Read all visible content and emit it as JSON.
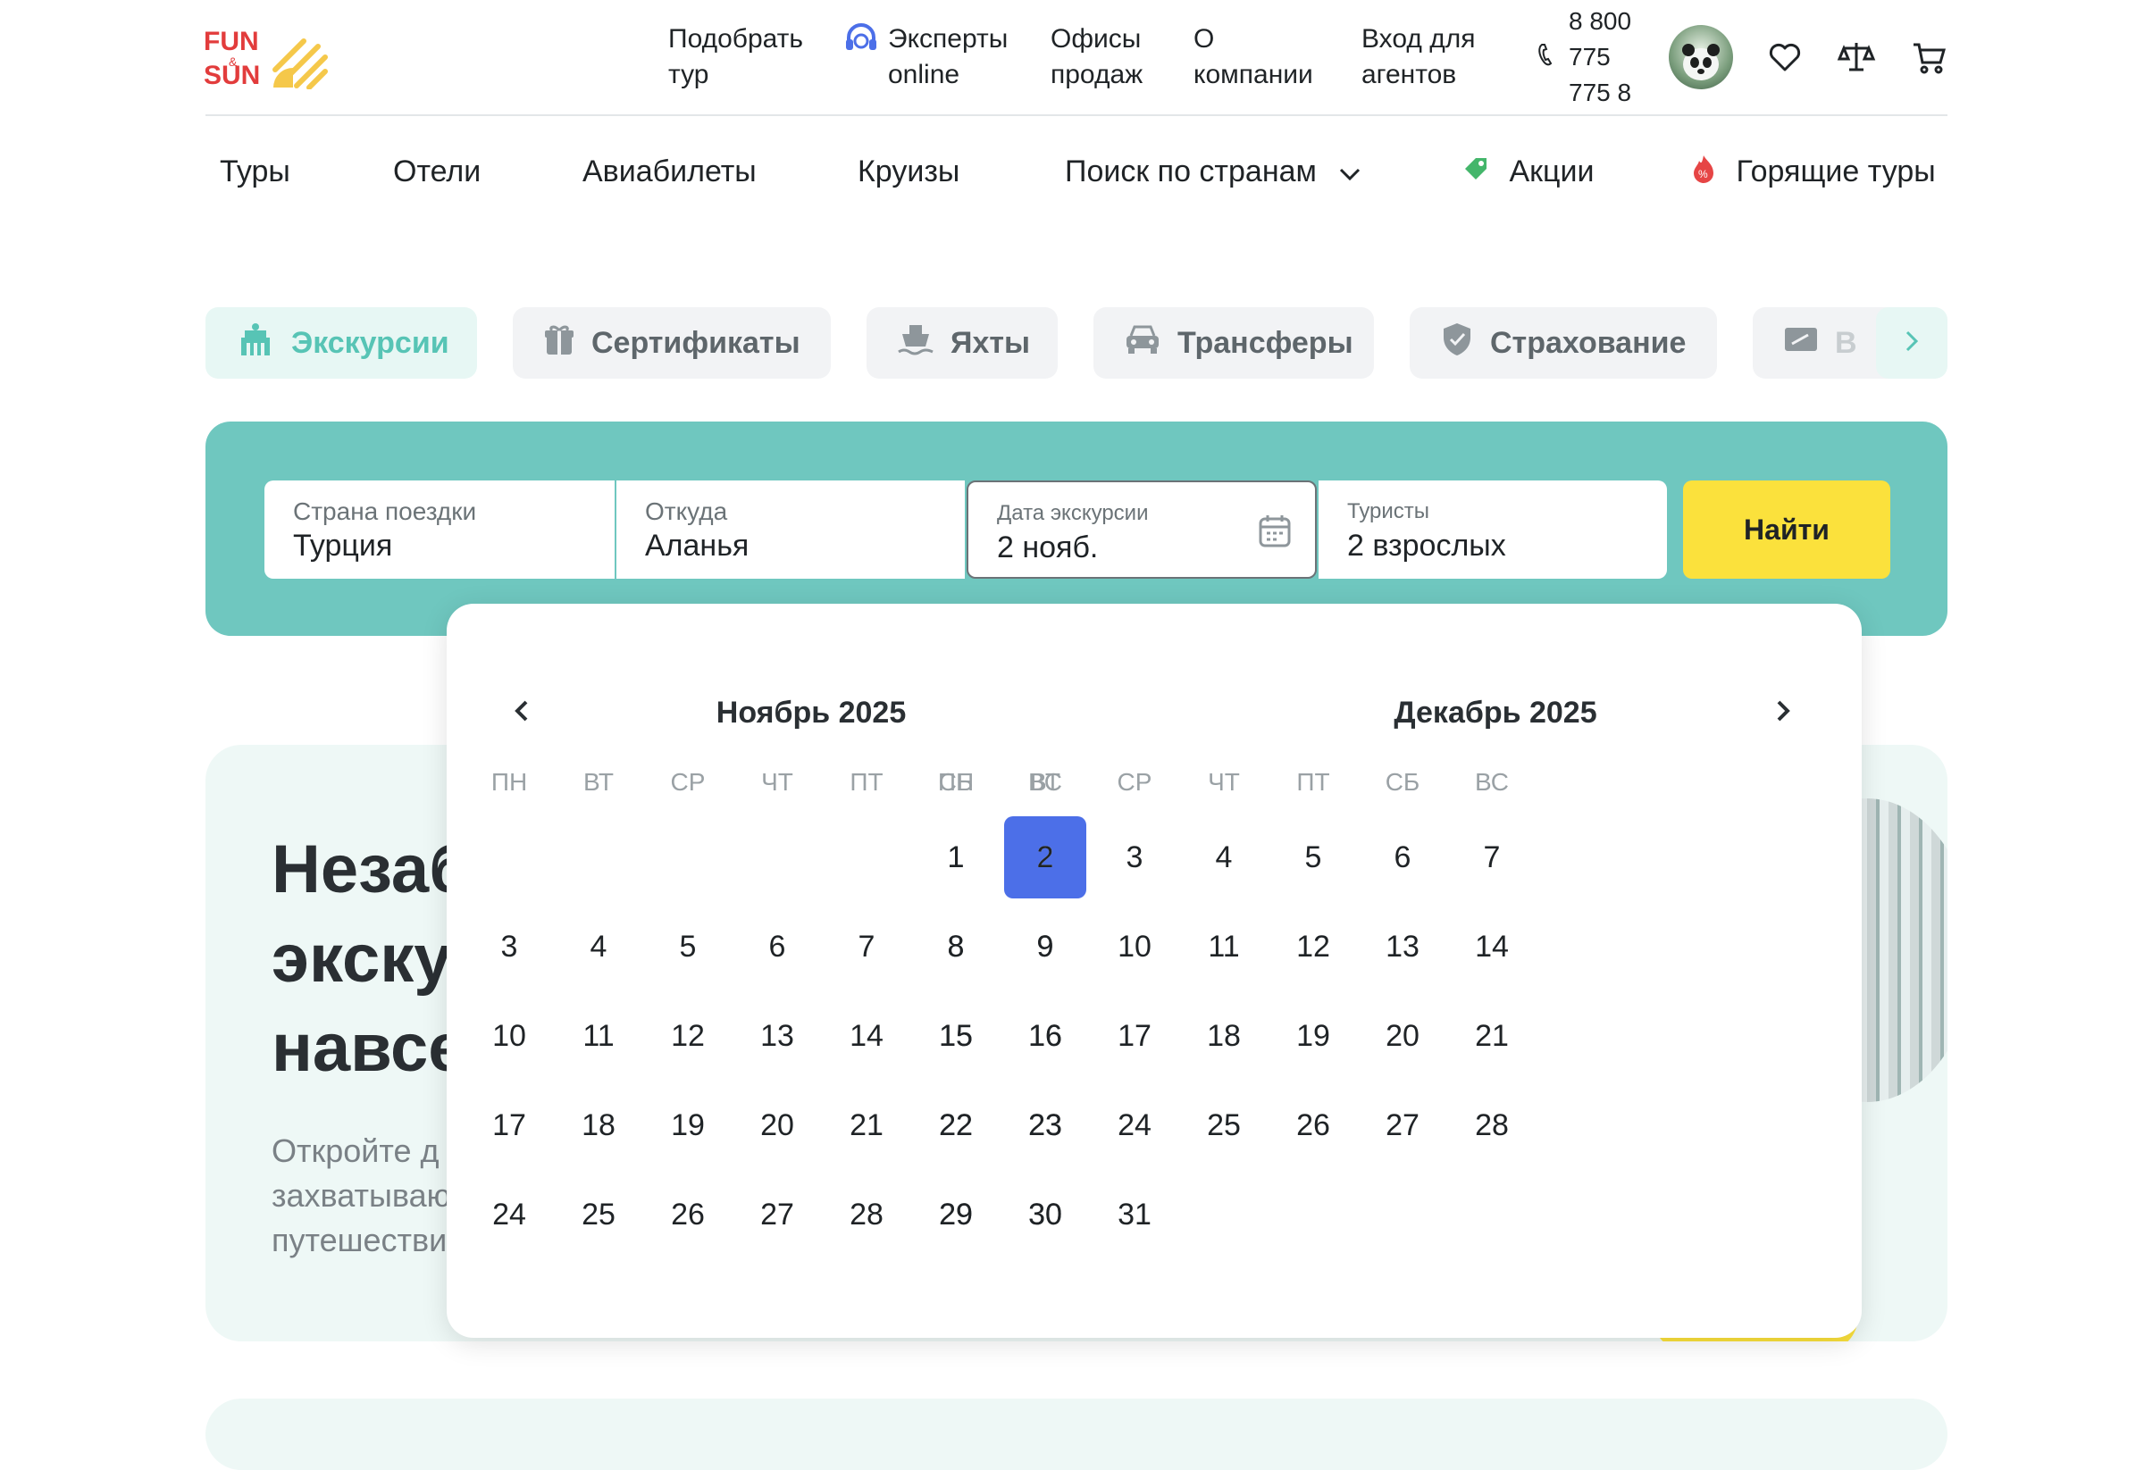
{
  "header": {
    "logo": {
      "line1": "FUN",
      "amp": "&",
      "line2": "SUN"
    },
    "nav": [
      {
        "line1": "Подобрать",
        "line2": "тур"
      },
      {
        "line1": "Эксперты",
        "line2": "online"
      },
      {
        "line1": "Офисы",
        "line2": "продаж"
      },
      {
        "line1": "О",
        "line2": "компании"
      },
      {
        "line1": "Вход для",
        "line2": "агентов"
      }
    ],
    "phone": {
      "line1": "8 800",
      "line2": "775",
      "line3": "775 8"
    },
    "icons": [
      "phone-icon",
      "avatar",
      "heart-icon",
      "compare-icon",
      "cart-icon"
    ]
  },
  "main_nav": {
    "items": [
      "Туры",
      "Отели",
      "Авиабилеты",
      "Круизы",
      "Поиск по странам",
      "Акции",
      "Горящие туры"
    ]
  },
  "service_tabs": {
    "items": [
      "Экскурсии",
      "Сертификаты",
      "Яхты",
      "Трансферы",
      "Страхование",
      "В"
    ],
    "active": "Экскурсии"
  },
  "search": {
    "country": {
      "label": "Страна поездки",
      "value": "Турция"
    },
    "from": {
      "label": "Откуда",
      "value": "Аланья"
    },
    "date": {
      "label": "Дата экскурсии",
      "value": "2 нояб."
    },
    "tourists": {
      "label": "Туристы",
      "value": "2 взрослых"
    },
    "button": "Найти"
  },
  "hero": {
    "title_lines": [
      "Незаб",
      "экску",
      "навсе"
    ],
    "subtitle_lines": [
      "Откройте д",
      "захватываю",
      "путешестви"
    ]
  },
  "calendar": {
    "weekdays": [
      "ПН",
      "ВТ",
      "СР",
      "ЧТ",
      "ПТ",
      "СБ",
      "ВС"
    ],
    "months": [
      {
        "title": "Ноябрь 2025",
        "first_weekday_index": 5,
        "days": 30,
        "selected": 2
      },
      {
        "title": "Декабрь 2025",
        "first_weekday_index": 0,
        "days": 31,
        "selected": null
      }
    ]
  },
  "colors": {
    "brand_teal": "#6fc7bf",
    "active_tab_text": "#57c4b5",
    "selected_day": "#4c6fe8",
    "find_button": "#fbe13c",
    "logo_red": "#e23c3c",
    "logo_yellow": "#f5c84a"
  }
}
